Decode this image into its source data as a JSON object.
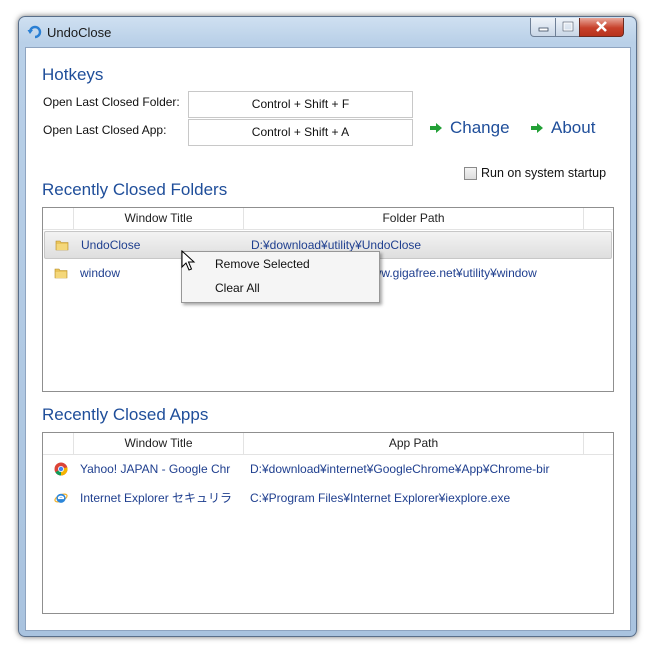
{
  "window": {
    "title": "UndoClose"
  },
  "hotkeys": {
    "heading": "Hotkeys",
    "folder_label": "Open Last Closed Folder:",
    "folder_value": "Control + Shift + F",
    "app_label": "Open Last Closed App:",
    "app_value": "Control + Shift + A",
    "change_label": "Change",
    "about_label": "About",
    "startup_label": "Run on system startup",
    "startup_checked": false
  },
  "folders": {
    "heading": "Recently Closed Folders",
    "columns": [
      "Window Title",
      "Folder Path"
    ],
    "rows": [
      {
        "title": "UndoClose",
        "path": "D:¥download¥utility¥UndoClose",
        "icon": "folder-icon"
      },
      {
        "title": "window",
        "path": "www.gigafree.net¥utility¥window",
        "icon": "folder-icon"
      }
    ]
  },
  "apps": {
    "heading": "Recently Closed Apps",
    "columns": [
      "Window Title",
      "App Path"
    ],
    "rows": [
      {
        "title": "Yahoo! JAPAN - Google Chr",
        "path": "D:¥download¥internet¥GoogleChrome¥App¥Chrome-bir",
        "icon": "chrome-icon"
      },
      {
        "title": "Internet Explorer セキュリラ",
        "path": "C:¥Program Files¥Internet Explorer¥iexplore.exe",
        "icon": "ie-icon"
      }
    ]
  },
  "context_menu": {
    "items": [
      "Remove Selected",
      "Clear All"
    ]
  },
  "colors": {
    "accent": "#1f4e9a",
    "link": "#1f3f8f",
    "arrow": "#22a036"
  }
}
